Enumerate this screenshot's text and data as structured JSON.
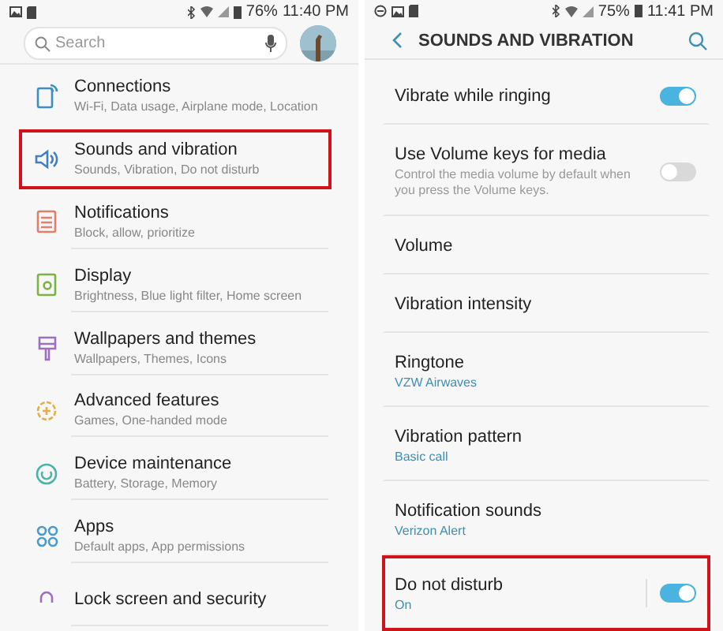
{
  "left_screen": {
    "status_bar": {
      "battery": "76%",
      "time": "11:40 PM"
    },
    "search": {
      "placeholder": "Search"
    },
    "items": [
      {
        "title": "Connections",
        "subtitle": "Wi-Fi, Data usage, Airplane mode, Location",
        "highlighted": false
      },
      {
        "title": "Sounds and vibration",
        "subtitle": "Sounds, Vibration, Do not disturb",
        "highlighted": true
      },
      {
        "title": "Notifications",
        "subtitle": "Block, allow, prioritize",
        "highlighted": false
      },
      {
        "title": "Display",
        "subtitle": "Brightness, Blue light filter, Home screen",
        "highlighted": false
      },
      {
        "title": "Wallpapers and themes",
        "subtitle": "Wallpapers, Themes, Icons",
        "highlighted": false
      },
      {
        "title": "Advanced features",
        "subtitle": "Games, One-handed mode",
        "highlighted": false
      },
      {
        "title": "Device maintenance",
        "subtitle": "Battery, Storage, Memory",
        "highlighted": false
      },
      {
        "title": "Apps",
        "subtitle": "Default apps, App permissions",
        "highlighted": false
      },
      {
        "title": "Lock screen and security",
        "highlighted": false
      }
    ]
  },
  "right_screen": {
    "status_bar": {
      "battery": "75%",
      "time": "11:41 PM"
    },
    "title": "SOUNDS AND VIBRATION",
    "items": [
      {
        "kind": "switch",
        "title": "Vibrate while ringing",
        "on": true,
        "highlighted": false
      },
      {
        "kind": "switch",
        "title": "Use Volume keys for media",
        "description": "Control the media volume by default when you press the Volume keys.",
        "on": false,
        "highlighted": false
      },
      {
        "kind": "plain",
        "title": "Volume",
        "highlighted": false
      },
      {
        "kind": "plain",
        "title": "Vibration intensity",
        "highlighted": false
      },
      {
        "kind": "plain",
        "title": "Ringtone",
        "value": "VZW Airwaves",
        "highlighted": false
      },
      {
        "kind": "plain",
        "title": "Vibration pattern",
        "value": "Basic call",
        "highlighted": false
      },
      {
        "kind": "plain",
        "title": "Notification sounds",
        "value": "Verizon Alert",
        "highlighted": false
      },
      {
        "kind": "switch",
        "title": "Do not disturb",
        "value": "On",
        "on": true,
        "highlighted": true
      }
    ]
  }
}
